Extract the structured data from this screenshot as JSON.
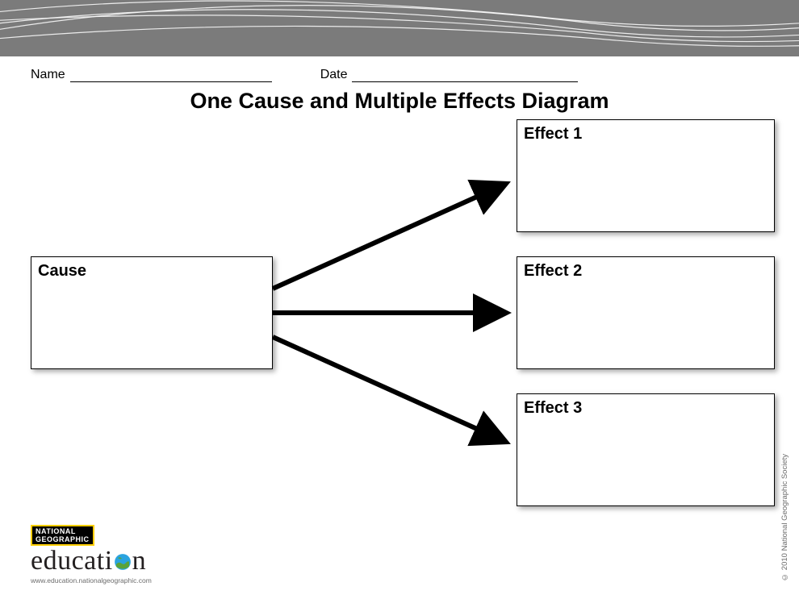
{
  "header": {
    "name_label": "Name",
    "date_label": "Date"
  },
  "title": "One Cause and Multiple Effects Diagram",
  "boxes": {
    "cause": "Cause",
    "effect1": "Effect 1",
    "effect2": "Effect 2",
    "effect3": "Effect 3"
  },
  "footer": {
    "brand_top": "NATIONAL",
    "brand_bottom": "GEOGRAPHIC",
    "wordmark_pre": "educati",
    "wordmark_post": "n",
    "url": "www.education.nationalgeographic.com",
    "copyright": "© 2010 National Geographic Society"
  }
}
